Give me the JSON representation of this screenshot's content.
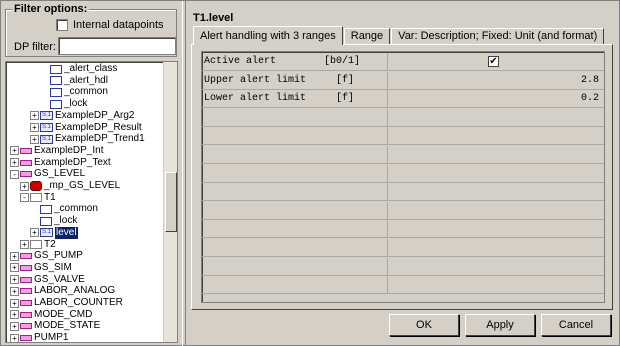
{
  "filter": {
    "legend": "Filter options:",
    "internal_label": "Internal datapoints",
    "dp_filter_label": "DP filter:",
    "dp_filter_value": ""
  },
  "tree": {
    "items": [
      {
        "label": "_alert_class",
        "icon": "dpe-icon"
      },
      {
        "label": "_alert_hdl",
        "icon": "dpe-icon"
      },
      {
        "label": "_common",
        "icon": "dpe-icon"
      },
      {
        "label": "_lock",
        "icon": "dpe-icon"
      },
      {
        "label": "ExampleDP_Arg2",
        "icon": "struct-icon",
        "expander": "+"
      },
      {
        "label": "ExampleDP_Result",
        "icon": "struct-icon",
        "expander": "+"
      },
      {
        "label": "ExampleDP_Trend1",
        "icon": "struct-icon",
        "expander": "+"
      },
      {
        "label": "ExampleDP_Int",
        "icon": "datapoint-icon",
        "expander": "+"
      },
      {
        "label": "ExampleDP_Text",
        "icon": "datapoint-icon",
        "expander": "+"
      },
      {
        "label": "GS_LEVEL",
        "icon": "datapoint-icon",
        "expander": "-"
      },
      {
        "label": "_mp_GS_LEVEL",
        "icon": "master-dp-icon",
        "expander": "+"
      },
      {
        "label": "T1",
        "icon": "folder-icon",
        "expander": "-"
      },
      {
        "label": "_common",
        "icon": "dpe-icon"
      },
      {
        "label": "_lock",
        "icon": "dpe-icon"
      },
      {
        "label": "level",
        "icon": "struct-icon",
        "expander": "+",
        "selected": true
      },
      {
        "label": "T2",
        "icon": "folder-icon",
        "expander": "+"
      },
      {
        "label": "GS_PUMP",
        "icon": "datapoint-icon",
        "expander": "+"
      },
      {
        "label": "GS_SIM",
        "icon": "datapoint-icon",
        "expander": "+"
      },
      {
        "label": "GS_VALVE",
        "icon": "datapoint-icon",
        "expander": "+"
      },
      {
        "label": "LABOR_ANALOG",
        "icon": "datapoint-icon",
        "expander": "+"
      },
      {
        "label": "LABOR_COUNTER",
        "icon": "datapoint-icon",
        "expander": "+"
      },
      {
        "label": "MODE_CMD",
        "icon": "datapoint-icon",
        "expander": "+"
      },
      {
        "label": "MODE_STATE",
        "icon": "datapoint-icon",
        "expander": "+"
      },
      {
        "label": "PUMP1",
        "icon": "datapoint-icon",
        "expander": "+"
      }
    ]
  },
  "panel": {
    "title": "T1.level",
    "tabs": [
      {
        "label": "Alert handling with 3 ranges",
        "active": true
      },
      {
        "label": "Range"
      },
      {
        "label": "Var: Description; Fixed: Unit (and format)"
      }
    ]
  },
  "grid": {
    "rows": [
      {
        "label": "Active alert        [b0/1]",
        "value": "",
        "checked": true
      },
      {
        "label": "Upper alert limit     [f]",
        "value": "2.8"
      },
      {
        "label": "Lower alert limit     [f]",
        "value": "0.2"
      }
    ],
    "empty_rows": 10
  },
  "buttons": {
    "ok": "OK",
    "apply": "Apply",
    "cancel": "Cancel"
  },
  "colors": {
    "selection": "#0a246a",
    "window": "#d4d0c8"
  }
}
